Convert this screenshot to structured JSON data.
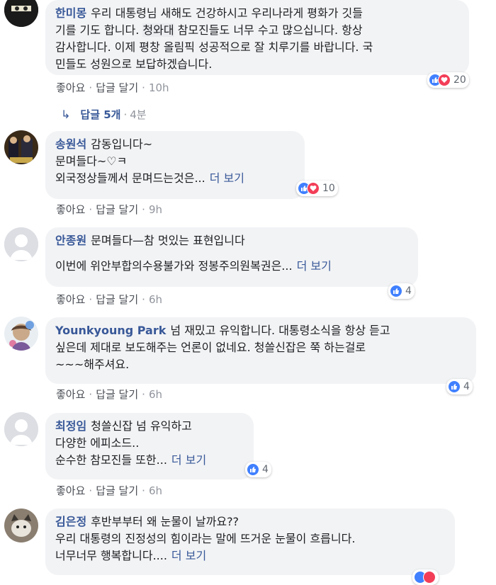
{
  "comments": [
    {
      "name": "한미몽",
      "lines": [
        {
          "pre": "우리 대통령님 새해도 건강하시고 우리나라게 평화가 깃들"
        },
        {
          "pre": "기를 기도 합니다. ",
          "hl": "청와대",
          "post": " 참모진들도 너무 수고 많으십니다. 항상"
        },
        {
          "pre": "감사합니다. 이제 평창 올림픽 성공적으로 잘 치루기를 바랍니다. 국"
        },
        {
          "pre": "민들도 성원으로 보답하겠습니다."
        }
      ],
      "reactions": {
        "count": "20",
        "types": [
          "like-icon",
          "love-icon"
        ]
      },
      "actions": {
        "like": "좋아요",
        "reply": "답글 달기",
        "time": "10h"
      }
    },
    {
      "name": "송원석",
      "lines": [
        {
          "pre": "감동입니다~"
        },
        {
          "pre": "문며들다~♡ㅋ"
        },
        {
          "pre": "외국정상들께서 문며드는것은...",
          "more": "더 보기"
        }
      ],
      "reactions": {
        "count": "10",
        "types": [
          "like-icon",
          "love-icon"
        ]
      },
      "actions": {
        "like": "좋아요",
        "reply": "답글 달기",
        "time": "9h"
      }
    },
    {
      "name": "안종원",
      "lines": [
        {
          "pre": "문며들다—참 멋있는 표현입니다"
        },
        {
          "pre": ""
        },
        {
          "pre": "이번에 위안부합의수용불가와 정봉주의원복권은...",
          "more": "더 보기"
        }
      ],
      "reactions": {
        "count": "4",
        "types": [
          "like-icon"
        ]
      },
      "actions": {
        "like": "좋아요",
        "reply": "답글 달기",
        "time": "6h"
      }
    },
    {
      "name": "Younkyoung Park",
      "lines": [
        {
          "pre": "넘 재밌고 유익합니다. 대통령소식을 항상 듣고"
        },
        {
          "pre": "싶은데 제대로 보도해주는 언론이 없네요. 청쓸신잡은 쭉 하는걸로"
        },
        {
          "pre": "~~~해주셔요."
        }
      ],
      "reactions": {
        "count": "4",
        "types": [
          "like-icon"
        ]
      },
      "actions": {
        "like": "좋아요",
        "reply": "답글 달기",
        "time": "6h"
      }
    },
    {
      "name": "최정임",
      "lines": [
        {
          "pre": "청쓸신잡 넘 유익하고"
        },
        {
          "pre": "다양한 에피소드.."
        },
        {
          "pre": "순수한 참모진들 또한...",
          "more": "더 보기"
        }
      ],
      "reactions": {
        "count": "4",
        "types": [
          "like-icon"
        ]
      },
      "actions": {
        "like": "좋아요",
        "reply": "답글 달기",
        "time": "6h"
      }
    },
    {
      "name": "김은정",
      "lines": [
        {
          "pre": "후반부부터 왜 눈물이 날까요??"
        },
        {
          "pre": "우리 대통령의 진정성의 힘이라는 말에 뜨거운 눈물이 흐릅니다."
        },
        {
          "pre": "너무너무 행복합니다....",
          "more": "더 보기"
        }
      ]
    }
  ],
  "replies_row": {
    "label": "답글 5개",
    "time": "4분"
  },
  "colors": {
    "link": "#385898",
    "bubble": "#f2f3f5",
    "like": "#4080ff",
    "love": "#f33e58",
    "meta": "#90949c"
  }
}
